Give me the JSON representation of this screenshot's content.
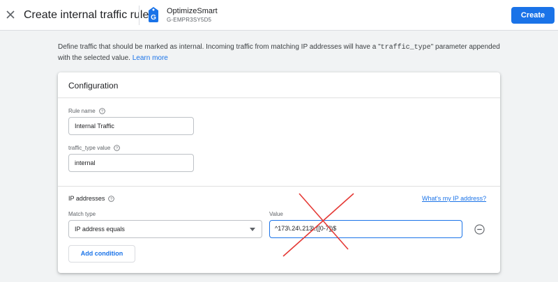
{
  "header": {
    "title": "Create internal traffic rule",
    "property_name": "OptimizeSmart",
    "property_id": "G-EMPR3SY5D5",
    "create_label": "Create"
  },
  "description": {
    "text_before": "Define traffic that should be marked as internal. Incoming traffic from matching IP addresses will have a \"",
    "code": "traffic_type",
    "text_after": "\" parameter appended with the selected value. ",
    "learn_more": "Learn more"
  },
  "config": {
    "title": "Configuration",
    "rule_name_label": "Rule name",
    "rule_name_value": "Internal Traffic",
    "traffic_type_label": "traffic_type value",
    "traffic_type_value": "internal"
  },
  "ip": {
    "title": "IP addresses",
    "whats_my_ip": "What's my IP address?",
    "match_type_label": "Match type",
    "match_type_value": "IP address equals",
    "value_label": "Value",
    "value": "^173\\.24\\.213\\.([0-7])$",
    "add_condition": "Add condition"
  },
  "colors": {
    "accent": "#1a73e8",
    "annotation_cross": "#e53935"
  },
  "icons": [
    "close-icon",
    "analytics-property-icon",
    "help-icon",
    "remove-circle-icon",
    "dropdown-caret-icon"
  ]
}
